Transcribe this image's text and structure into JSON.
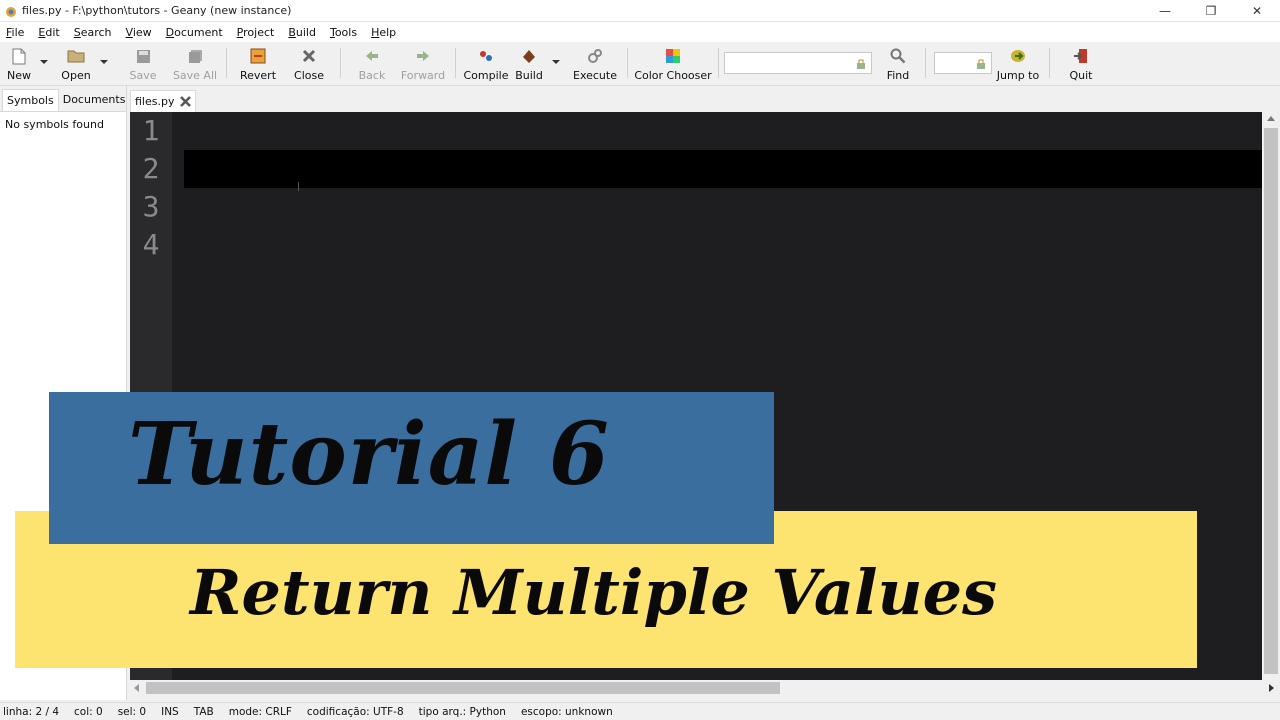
{
  "window": {
    "title": "files.py - F:\\python\\tutors - Geany (new instance)",
    "minimize": "—",
    "maximize": "❐",
    "close": "✕"
  },
  "menu": [
    "File",
    "Edit",
    "Search",
    "View",
    "Document",
    "Project",
    "Build",
    "Tools",
    "Help"
  ],
  "toolbar": {
    "new": "New",
    "open": "Open",
    "save": "Save",
    "save_all": "Save All",
    "revert": "Revert",
    "close": "Close",
    "back": "Back",
    "forward": "Forward",
    "compile": "Compile",
    "build": "Build",
    "execute": "Execute",
    "color_chooser": "Color Chooser",
    "find": "Find",
    "jump_to": "Jump to",
    "quit": "Quit",
    "search_value": "",
    "line_value": ""
  },
  "sidebar": {
    "tabs": [
      "Symbols",
      "Documents"
    ],
    "message": "No symbols found"
  },
  "document_tab": "files.py",
  "editor": {
    "line_numbers": [
      "1",
      "2",
      "3",
      "4"
    ]
  },
  "statusbar": {
    "line": "linha: 2 / 4",
    "col": "col: 0",
    "sel": "sel: 0",
    "ins": "INS",
    "tab": "TAB",
    "mode": "mode: CRLF",
    "encoding": "codificação: UTF-8",
    "filetype": "tipo arq.: Python",
    "scope": "escopo: unknown"
  },
  "overlay": {
    "title": "Tutorial 6",
    "subtitle": "Return Multiple Values"
  },
  "colors": {
    "editor_bg": "#1e1e20",
    "banner_blue": "#3a6e9f",
    "banner_yellow": "#fde36f"
  }
}
